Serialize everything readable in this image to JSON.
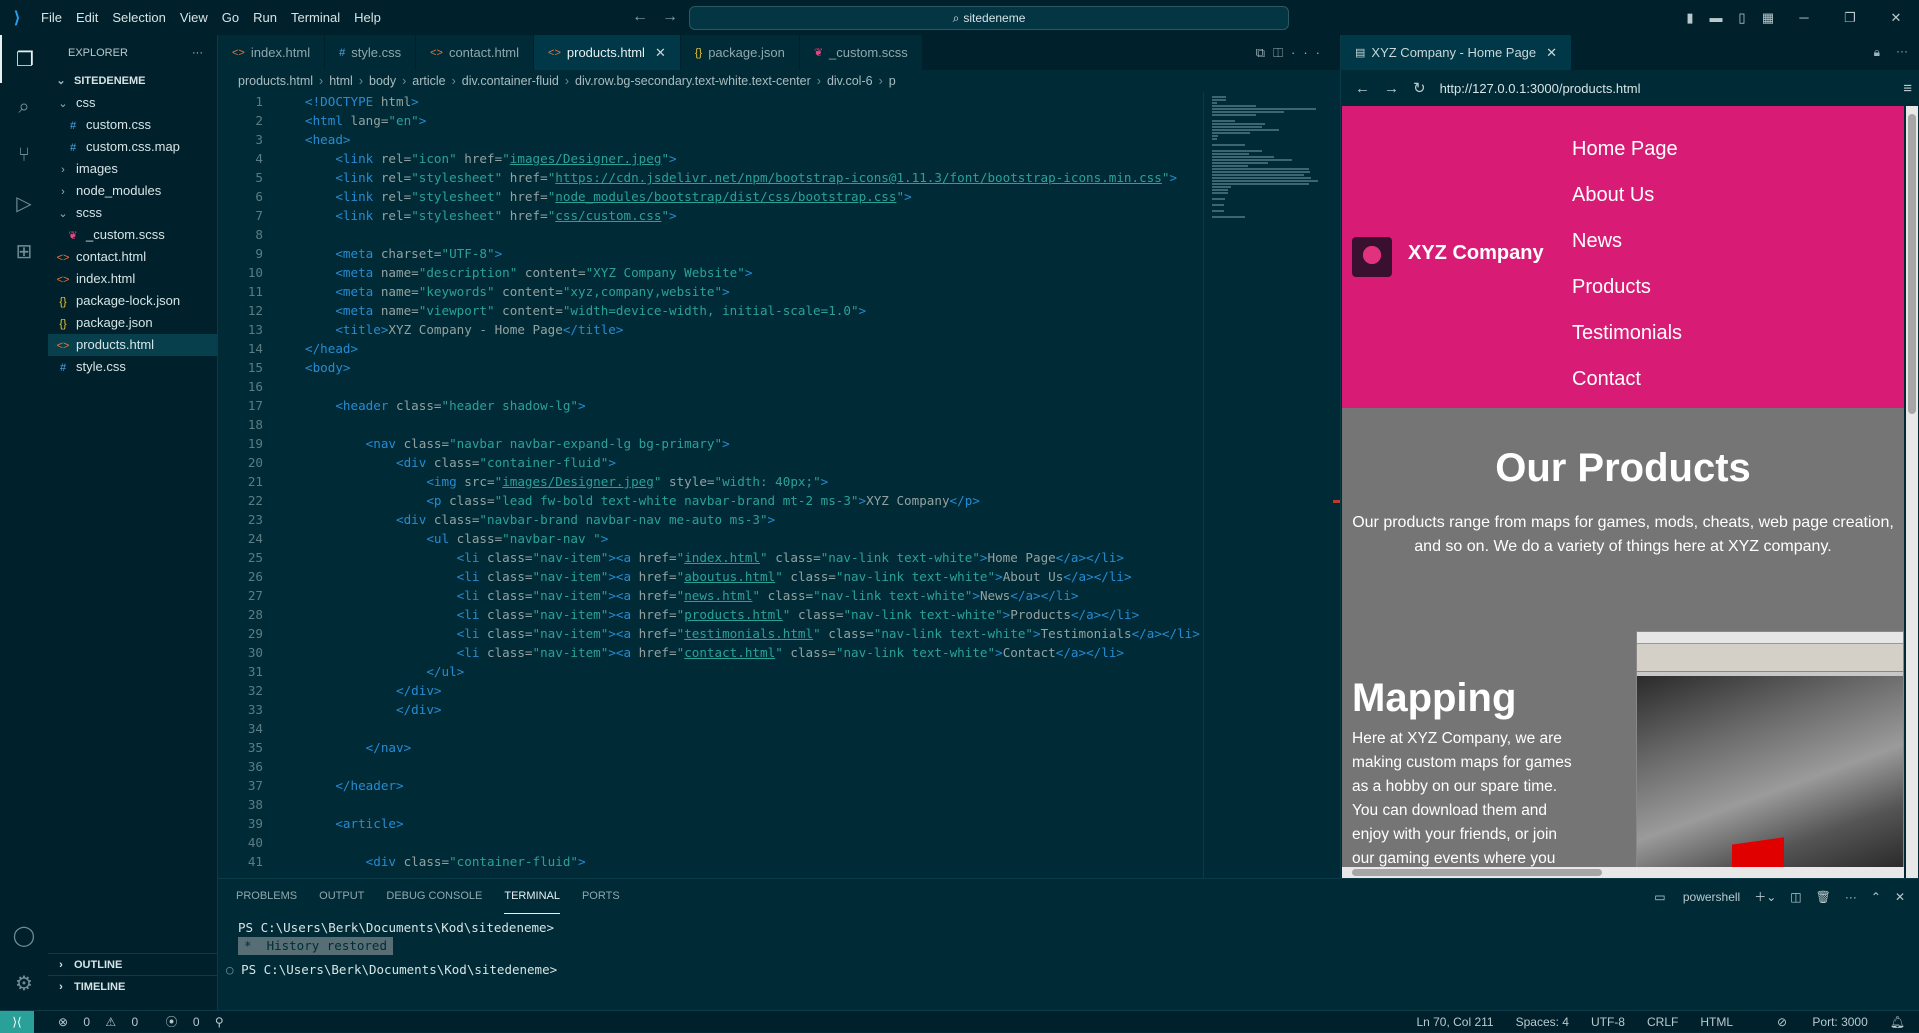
{
  "titlebar": {
    "menu": [
      "File",
      "Edit",
      "Selection",
      "View",
      "Go",
      "Run",
      "Terminal",
      "Help"
    ],
    "search": "sitedeneme"
  },
  "sidebar": {
    "title": "EXPLORER",
    "root": "SITEDENEME",
    "items": [
      {
        "label": "css",
        "kind": "folder-open",
        "depth": 1
      },
      {
        "label": "custom.css",
        "kind": "css",
        "depth": 2
      },
      {
        "label": "custom.css.map",
        "kind": "css",
        "depth": 2
      },
      {
        "label": "images",
        "kind": "folder",
        "depth": 1
      },
      {
        "label": "node_modules",
        "kind": "folder",
        "depth": 1
      },
      {
        "label": "scss",
        "kind": "folder-open",
        "depth": 1
      },
      {
        "label": "_custom.scss",
        "kind": "scss",
        "depth": 2
      },
      {
        "label": "contact.html",
        "kind": "html",
        "depth": 1
      },
      {
        "label": "index.html",
        "kind": "html",
        "depth": 1
      },
      {
        "label": "package-lock.json",
        "kind": "json",
        "depth": 1
      },
      {
        "label": "package.json",
        "kind": "json",
        "depth": 1
      },
      {
        "label": "products.html",
        "kind": "html",
        "depth": 1,
        "selected": true
      },
      {
        "label": "style.css",
        "kind": "css",
        "depth": 1
      }
    ],
    "outline": "OUTLINE",
    "timeline": "TIMELINE"
  },
  "tabs": [
    {
      "label": "index.html",
      "kind": "html"
    },
    {
      "label": "style.css",
      "kind": "css"
    },
    {
      "label": "contact.html",
      "kind": "html"
    },
    {
      "label": "products.html",
      "kind": "html",
      "active": true
    },
    {
      "label": "package.json",
      "kind": "json"
    },
    {
      "label": "_custom.scss",
      "kind": "scss"
    }
  ],
  "breadcrumb": [
    "products.html",
    "html",
    "body",
    "article",
    "div.container-fluid",
    "div.row.bg-secondary.text-white.text-center",
    "div.col-6",
    "p"
  ],
  "code": [
    [
      [
        "tg",
        "<!DOCTYPE "
      ],
      [
        "at",
        "html"
      ],
      [
        "tg",
        ">"
      ]
    ],
    [
      [
        "tg",
        "<html "
      ],
      [
        "at",
        "lang="
      ],
      [
        "st",
        "\"en\""
      ],
      [
        "tg",
        ">"
      ]
    ],
    [
      [
        "tg",
        "<head>"
      ]
    ],
    [
      [
        "tx",
        "    "
      ],
      [
        "tg",
        "<link "
      ],
      [
        "at",
        "rel="
      ],
      [
        "st",
        "\"icon\" "
      ],
      [
        "at",
        "href="
      ],
      [
        "st",
        "\""
      ],
      [
        "url",
        "images/Designer.jpeg"
      ],
      [
        "st",
        "\""
      ],
      [
        "tg",
        ">"
      ]
    ],
    [
      [
        "tx",
        "    "
      ],
      [
        "tg",
        "<link "
      ],
      [
        "at",
        "rel="
      ],
      [
        "st",
        "\"stylesheet\" "
      ],
      [
        "at",
        "href="
      ],
      [
        "st",
        "\""
      ],
      [
        "url",
        "https://cdn.jsdelivr.net/npm/bootstrap-icons@1.11.3/font/bootstrap-icons.min.css"
      ],
      [
        "st",
        "\""
      ],
      [
        "tg",
        ">"
      ]
    ],
    [
      [
        "tx",
        "    "
      ],
      [
        "tg",
        "<link "
      ],
      [
        "at",
        "rel="
      ],
      [
        "st",
        "\"stylesheet\" "
      ],
      [
        "at",
        "href="
      ],
      [
        "st",
        "\""
      ],
      [
        "url",
        "node_modules/bootstrap/dist/css/bootstrap.css"
      ],
      [
        "st",
        "\""
      ],
      [
        "tg",
        ">"
      ]
    ],
    [
      [
        "tx",
        "    "
      ],
      [
        "tg",
        "<link "
      ],
      [
        "at",
        "rel="
      ],
      [
        "st",
        "\"stylesheet\" "
      ],
      [
        "at",
        "href="
      ],
      [
        "st",
        "\""
      ],
      [
        "url",
        "css/custom.css"
      ],
      [
        "st",
        "\""
      ],
      [
        "tg",
        ">"
      ]
    ],
    [],
    [
      [
        "tx",
        "    "
      ],
      [
        "tg",
        "<meta "
      ],
      [
        "at",
        "charset="
      ],
      [
        "st",
        "\"UTF-8\""
      ],
      [
        "tg",
        ">"
      ]
    ],
    [
      [
        "tx",
        "    "
      ],
      [
        "tg",
        "<meta "
      ],
      [
        "at",
        "name="
      ],
      [
        "st",
        "\"description\" "
      ],
      [
        "at",
        "content="
      ],
      [
        "st",
        "\"XYZ Company Website\""
      ],
      [
        "tg",
        ">"
      ]
    ],
    [
      [
        "tx",
        "    "
      ],
      [
        "tg",
        "<meta "
      ],
      [
        "at",
        "name="
      ],
      [
        "st",
        "\"keywords\" "
      ],
      [
        "at",
        "content="
      ],
      [
        "st",
        "\"xyz,company,website\""
      ],
      [
        "tg",
        ">"
      ]
    ],
    [
      [
        "tx",
        "    "
      ],
      [
        "tg",
        "<meta "
      ],
      [
        "at",
        "name="
      ],
      [
        "st",
        "\"viewport\" "
      ],
      [
        "at",
        "content="
      ],
      [
        "st",
        "\"width=device-width, initial-scale=1.0\""
      ],
      [
        "tg",
        ">"
      ]
    ],
    [
      [
        "tx",
        "    "
      ],
      [
        "tg",
        "<title>"
      ],
      [
        "tx",
        "XYZ Company - Home Page"
      ],
      [
        "tg",
        "</title>"
      ]
    ],
    [
      [
        "tg",
        "</head>"
      ]
    ],
    [
      [
        "tg",
        "<body>"
      ]
    ],
    [],
    [
      [
        "tx",
        "    "
      ],
      [
        "tg",
        "<header "
      ],
      [
        "at",
        "class="
      ],
      [
        "st",
        "\"header shadow-lg\""
      ],
      [
        "tg",
        ">"
      ]
    ],
    [],
    [
      [
        "tx",
        "        "
      ],
      [
        "tg",
        "<nav "
      ],
      [
        "at",
        "class="
      ],
      [
        "st",
        "\"navbar navbar-expand-lg bg-primary\""
      ],
      [
        "tg",
        ">"
      ]
    ],
    [
      [
        "tx",
        "            "
      ],
      [
        "tg",
        "<div "
      ],
      [
        "at",
        "class="
      ],
      [
        "st",
        "\"container-fluid\""
      ],
      [
        "tg",
        ">"
      ]
    ],
    [
      [
        "tx",
        "                "
      ],
      [
        "tg",
        "<img "
      ],
      [
        "at",
        "src="
      ],
      [
        "st",
        "\""
      ],
      [
        "url",
        "images/Designer.jpeg"
      ],
      [
        "st",
        "\" "
      ],
      [
        "at",
        "style="
      ],
      [
        "st",
        "\"width: 40px;\""
      ],
      [
        "tg",
        ">"
      ]
    ],
    [
      [
        "tx",
        "                "
      ],
      [
        "tg",
        "<p "
      ],
      [
        "at",
        "class="
      ],
      [
        "st",
        "\"lead fw-bold text-white navbar-brand mt-2 ms-3\""
      ],
      [
        "tg",
        ">"
      ],
      [
        "tx",
        "XYZ Company"
      ],
      [
        "tg",
        "</p>"
      ]
    ],
    [
      [
        "tx",
        "            "
      ],
      [
        "tg",
        "<div "
      ],
      [
        "at",
        "class="
      ],
      [
        "st",
        "\"navbar-brand navbar-nav me-auto ms-3\""
      ],
      [
        "tg",
        ">"
      ]
    ],
    [
      [
        "tx",
        "                "
      ],
      [
        "tg",
        "<ul "
      ],
      [
        "at",
        "class="
      ],
      [
        "st",
        "\"navbar-nav \""
      ],
      [
        "tg",
        ">"
      ]
    ],
    [
      [
        "tx",
        "                    "
      ],
      [
        "tg",
        "<li "
      ],
      [
        "at",
        "class="
      ],
      [
        "st",
        "\"nav-item\""
      ],
      [
        "tg",
        "><a "
      ],
      [
        "at",
        "href="
      ],
      [
        "st",
        "\""
      ],
      [
        "url",
        "index.html"
      ],
      [
        "st",
        "\" "
      ],
      [
        "at",
        "class="
      ],
      [
        "st",
        "\"nav-link text-white\""
      ],
      [
        "tg",
        ">"
      ],
      [
        "tx",
        "Home Page"
      ],
      [
        "tg",
        "</a></li>"
      ]
    ],
    [
      [
        "tx",
        "                    "
      ],
      [
        "tg",
        "<li "
      ],
      [
        "at",
        "class="
      ],
      [
        "st",
        "\"nav-item\""
      ],
      [
        "tg",
        "><a "
      ],
      [
        "at",
        "href="
      ],
      [
        "st",
        "\""
      ],
      [
        "url",
        "aboutus.html"
      ],
      [
        "st",
        "\" "
      ],
      [
        "at",
        "class="
      ],
      [
        "st",
        "\"nav-link text-white\""
      ],
      [
        "tg",
        ">"
      ],
      [
        "tx",
        "About Us"
      ],
      [
        "tg",
        "</a></li>"
      ]
    ],
    [
      [
        "tx",
        "                    "
      ],
      [
        "tg",
        "<li "
      ],
      [
        "at",
        "class="
      ],
      [
        "st",
        "\"nav-item\""
      ],
      [
        "tg",
        "><a "
      ],
      [
        "at",
        "href="
      ],
      [
        "st",
        "\""
      ],
      [
        "url",
        "news.html"
      ],
      [
        "st",
        "\" "
      ],
      [
        "at",
        "class="
      ],
      [
        "st",
        "\"nav-link text-white\""
      ],
      [
        "tg",
        ">"
      ],
      [
        "tx",
        "News"
      ],
      [
        "tg",
        "</a></li>"
      ]
    ],
    [
      [
        "tx",
        "                    "
      ],
      [
        "tg",
        "<li "
      ],
      [
        "at",
        "class="
      ],
      [
        "st",
        "\"nav-item\""
      ],
      [
        "tg",
        "><a "
      ],
      [
        "at",
        "href="
      ],
      [
        "st",
        "\""
      ],
      [
        "url",
        "products.html"
      ],
      [
        "st",
        "\" "
      ],
      [
        "at",
        "class="
      ],
      [
        "st",
        "\"nav-link text-white\""
      ],
      [
        "tg",
        ">"
      ],
      [
        "tx",
        "Products"
      ],
      [
        "tg",
        "</a></li>"
      ]
    ],
    [
      [
        "tx",
        "                    "
      ],
      [
        "tg",
        "<li "
      ],
      [
        "at",
        "class="
      ],
      [
        "st",
        "\"nav-item\""
      ],
      [
        "tg",
        "><a "
      ],
      [
        "at",
        "href="
      ],
      [
        "st",
        "\""
      ],
      [
        "url",
        "testimonials.html"
      ],
      [
        "st",
        "\" "
      ],
      [
        "at",
        "class="
      ],
      [
        "st",
        "\"nav-link text-white\""
      ],
      [
        "tg",
        ">"
      ],
      [
        "tx",
        "Testimonials"
      ],
      [
        "tg",
        "</a></li>"
      ]
    ],
    [
      [
        "tx",
        "                    "
      ],
      [
        "tg",
        "<li "
      ],
      [
        "at",
        "class="
      ],
      [
        "st",
        "\"nav-item\""
      ],
      [
        "tg",
        "><a "
      ],
      [
        "at",
        "href="
      ],
      [
        "st",
        "\""
      ],
      [
        "url",
        "contact.html"
      ],
      [
        "st",
        "\" "
      ],
      [
        "at",
        "class="
      ],
      [
        "st",
        "\"nav-link text-white\""
      ],
      [
        "tg",
        ">"
      ],
      [
        "tx",
        "Contact"
      ],
      [
        "tg",
        "</a></li>"
      ]
    ],
    [
      [
        "tx",
        "                "
      ],
      [
        "tg",
        "</ul>"
      ]
    ],
    [
      [
        "tx",
        "            "
      ],
      [
        "tg",
        "</div>"
      ]
    ],
    [
      [
        "tx",
        "            "
      ],
      [
        "tg",
        "</div>"
      ]
    ],
    [],
    [
      [
        "tx",
        "        "
      ],
      [
        "tg",
        "</nav>"
      ]
    ],
    [],
    [
      [
        "tx",
        "    "
      ],
      [
        "tg",
        "</header>"
      ]
    ],
    [],
    [
      [
        "tx",
        "    "
      ],
      [
        "tg",
        "<article>"
      ]
    ],
    [],
    [
      [
        "tx",
        "        "
      ],
      [
        "tg",
        "<div "
      ],
      [
        "at",
        "class="
      ],
      [
        "st",
        "\"container-fluid\""
      ],
      [
        "tg",
        ">"
      ]
    ]
  ],
  "browser": {
    "tab_title": "XYZ Company - Home Page",
    "url": "http://127.0.0.1:3000/products.html",
    "brand": "XYZ Company",
    "nav": [
      "Home Page",
      "About Us",
      "News",
      "Products",
      "Testimonials",
      "Contact"
    ],
    "products_title": "Our Products",
    "products_desc": "Our products range from maps for games, mods, cheats, web page creation, and so on. We do a variety of things here at XYZ company.",
    "mapping_title": "Mapping",
    "mapping_desc": "Here at XYZ Company, we are making custom maps for games as a hobby on our spare time. You can download them and enjoy with your friends, or join our gaming events where you can have fun with us!",
    "header_color": "#d81b75"
  },
  "panel": {
    "tabs": [
      "PROBLEMS",
      "OUTPUT",
      "DEBUG CONSOLE",
      "TERMINAL",
      "PORTS"
    ],
    "active_tab": "TERMINAL",
    "shell": "powershell",
    "lines": [
      "PS C:\\Users\\Berk\\Documents\\Kod\\sitedeneme>",
      "History restored",
      "PS C:\\Users\\Berk\\Documents\\Kod\\sitedeneme>"
    ]
  },
  "status": {
    "errors": "0",
    "warnings": "0",
    "ports": "0",
    "position": "Ln 70, Col 211",
    "spaces": "Spaces: 4",
    "encoding": "UTF-8",
    "eol": "CRLF",
    "language": "HTML",
    "port": "Port: 3000"
  }
}
